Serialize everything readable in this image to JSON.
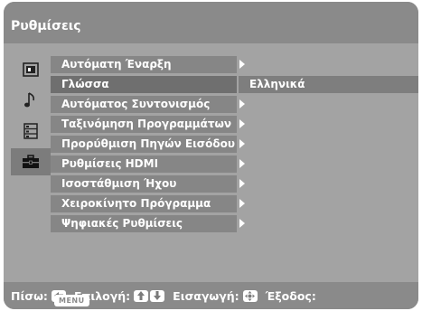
{
  "window": {
    "title": "Ρυθμίσεις"
  },
  "categories": [
    {
      "icon": "picture-icon",
      "selected": false
    },
    {
      "icon": "music-note-icon",
      "selected": false
    },
    {
      "icon": "channel-list-icon",
      "selected": false
    },
    {
      "icon": "toolbox-icon",
      "selected": true
    }
  ],
  "menu": {
    "items": [
      {
        "label": "Αυτόματη Έναρξη",
        "has_submenu": true,
        "selected": false,
        "value": ""
      },
      {
        "label": "Γλώσσα",
        "has_submenu": false,
        "selected": true,
        "value": "Ελληνικά"
      },
      {
        "label": "Αυτόματος Συντονισμός",
        "has_submenu": true,
        "selected": false,
        "value": ""
      },
      {
        "label": "Ταξινόμηση Προγραμμάτων",
        "has_submenu": true,
        "selected": false,
        "value": ""
      },
      {
        "label": "Προρύθμιση Πηγών Εισόδου",
        "has_submenu": true,
        "selected": false,
        "value": ""
      },
      {
        "label": "Ρυθμίσεις HDMI",
        "has_submenu": true,
        "selected": false,
        "value": ""
      },
      {
        "label": "Ισοστάθμιση Ήχου",
        "has_submenu": true,
        "selected": false,
        "value": ""
      },
      {
        "label": "Χειροκίνητο  Πρόγραμμα",
        "has_submenu": true,
        "selected": false,
        "value": ""
      },
      {
        "label": "Ψηφιακές Ρυθμίσεις",
        "has_submenu": true,
        "selected": false,
        "value": ""
      }
    ]
  },
  "footer": {
    "back_label": "Πίσω:",
    "back_icon": "left-arrow-key-icon",
    "select_label": "Επιλογή:",
    "select_icons": [
      "up-arrow-key-icon",
      "down-arrow-key-icon"
    ],
    "enter_label": "Εισαγωγή:",
    "enter_icon": "enter-key-icon",
    "exit_label": "Έξοδος:",
    "exit_key": "MENU"
  },
  "colors": {
    "title_bar": "#8a8a8a",
    "body": "#a3a3a3",
    "row": "#868686",
    "row_selected": "#6f6f6f",
    "value_bar": "#7e7e7e",
    "text": "#ffffff"
  }
}
